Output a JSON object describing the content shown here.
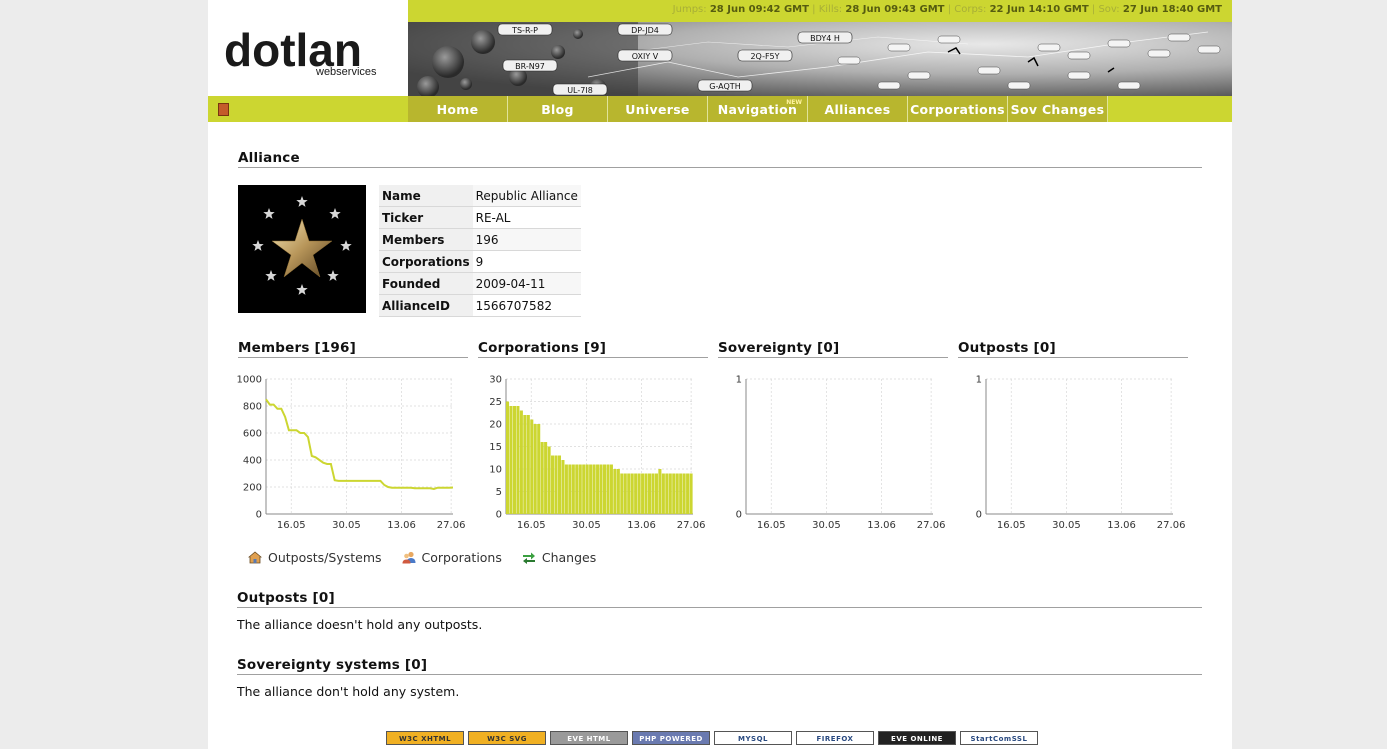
{
  "status": {
    "jumps_label": "Jumps:",
    "jumps": "28 Jun 09:42 GMT",
    "kills_label": "Kills:",
    "kills": "28 Jun 09:43 GMT",
    "corps_label": "Corps:",
    "corps": "22 Jun 14:10 GMT",
    "sov_label": "Sov:",
    "sov": "27 Jun 18:40 GMT"
  },
  "logo": {
    "main": "dotlan",
    "sub": "webservices"
  },
  "banner_labels": [
    "TS-R-P",
    "DP-JD4",
    "BR-N97",
    "OXIY V",
    "UL-7I8",
    "2Q-F5Y",
    "G-AQTH",
    "BDY4 H"
  ],
  "nav": [
    {
      "label": "Home"
    },
    {
      "label": "Blog"
    },
    {
      "label": "Universe"
    },
    {
      "label": "Navigation",
      "badge": "NEW"
    },
    {
      "label": "Alliances"
    },
    {
      "label": "Corporations"
    },
    {
      "label": "Sov Changes"
    }
  ],
  "alliance": {
    "section_title": "Alliance",
    "rows": [
      {
        "key": "Name",
        "value": "Republic Alliance"
      },
      {
        "key": "Ticker",
        "value": "RE-AL"
      },
      {
        "key": "Members",
        "value": "196"
      },
      {
        "key": "Corporations",
        "value": "9"
      },
      {
        "key": "Founded",
        "value": "2009-04-11"
      },
      {
        "key": "AllianceID",
        "value": "1566707582"
      }
    ]
  },
  "charts_titles": [
    "Members [196]",
    "Corporations [9]",
    "Sovereignty [0]",
    "Outposts [0]"
  ],
  "chart_data": [
    {
      "type": "line",
      "title": "Members [196]",
      "x_ticks": [
        "16.05",
        "30.05",
        "13.06",
        "27.06"
      ],
      "ylim": [
        0,
        1000
      ],
      "yticks": [
        0,
        200,
        400,
        600,
        800,
        1000
      ],
      "color": "#ccd631",
      "values": [
        850,
        810,
        810,
        780,
        780,
        720,
        620,
        620,
        620,
        600,
        600,
        570,
        430,
        420,
        400,
        380,
        370,
        370,
        250,
        245,
        245,
        245,
        245,
        245,
        245,
        245,
        245,
        245,
        245,
        245,
        245,
        215,
        200,
        195,
        195,
        195,
        195,
        195,
        195,
        190,
        190,
        190,
        190,
        190,
        185,
        195,
        195,
        195,
        195,
        196
      ]
    },
    {
      "type": "bar",
      "title": "Corporations [9]",
      "x_ticks": [
        "16.05",
        "30.05",
        "13.06",
        "27.06"
      ],
      "ylim": [
        0,
        30
      ],
      "yticks": [
        0,
        5,
        10,
        15,
        20,
        25,
        30
      ],
      "color": "#ccd631",
      "values": [
        25,
        24,
        24,
        24,
        23,
        22,
        22,
        21,
        20,
        20,
        16,
        16,
        15,
        13,
        13,
        13,
        12,
        11,
        11,
        11,
        11,
        11,
        11,
        11,
        11,
        11,
        11,
        11,
        11,
        11,
        11,
        10,
        10,
        9,
        9,
        9,
        9,
        9,
        9,
        9,
        9,
        9,
        9,
        9,
        10,
        9,
        9,
        9,
        9,
        9,
        9,
        9,
        9,
        9
      ]
    },
    {
      "type": "line",
      "title": "Sovereignty [0]",
      "x_ticks": [
        "16.05",
        "30.05",
        "13.06",
        "27.06"
      ],
      "ylim": [
        0,
        1
      ],
      "yticks": [
        0,
        1
      ],
      "color": "#ccd631",
      "values": []
    },
    {
      "type": "line",
      "title": "Outposts [0]",
      "x_ticks": [
        "16.05",
        "30.05",
        "13.06",
        "27.06"
      ],
      "ylim": [
        0,
        1
      ],
      "yticks": [
        0,
        1
      ],
      "color": "#ccd631",
      "values": []
    }
  ],
  "links": [
    {
      "label": "Outposts/Systems",
      "icon": "house-icon"
    },
    {
      "label": "Corporations",
      "icon": "people-icon"
    },
    {
      "label": "Changes",
      "icon": "arrows-icon"
    }
  ],
  "outposts": {
    "title": "Outposts [0]",
    "text": "The alliance doesn't hold any outposts."
  },
  "sovereignty": {
    "title": "Sovereignty systems [0]",
    "text": "The alliance don't hold any system."
  },
  "badges": [
    {
      "label": "W3C XHTML",
      "color": "#f0b023"
    },
    {
      "label": "W3C SVG",
      "color": "#f0b023"
    },
    {
      "label": "EVE HTML",
      "color": "#9a9a9a"
    },
    {
      "label": "PHP POWERED",
      "color": "#6a7ab0"
    },
    {
      "label": "MYSQL",
      "color": "#ffffff"
    },
    {
      "label": "FIREFOX",
      "color": "#ffffff"
    },
    {
      "label": "EVE ONLINE",
      "color": "#222222"
    },
    {
      "label": "StartComSSL",
      "color": "#ffffff"
    }
  ]
}
